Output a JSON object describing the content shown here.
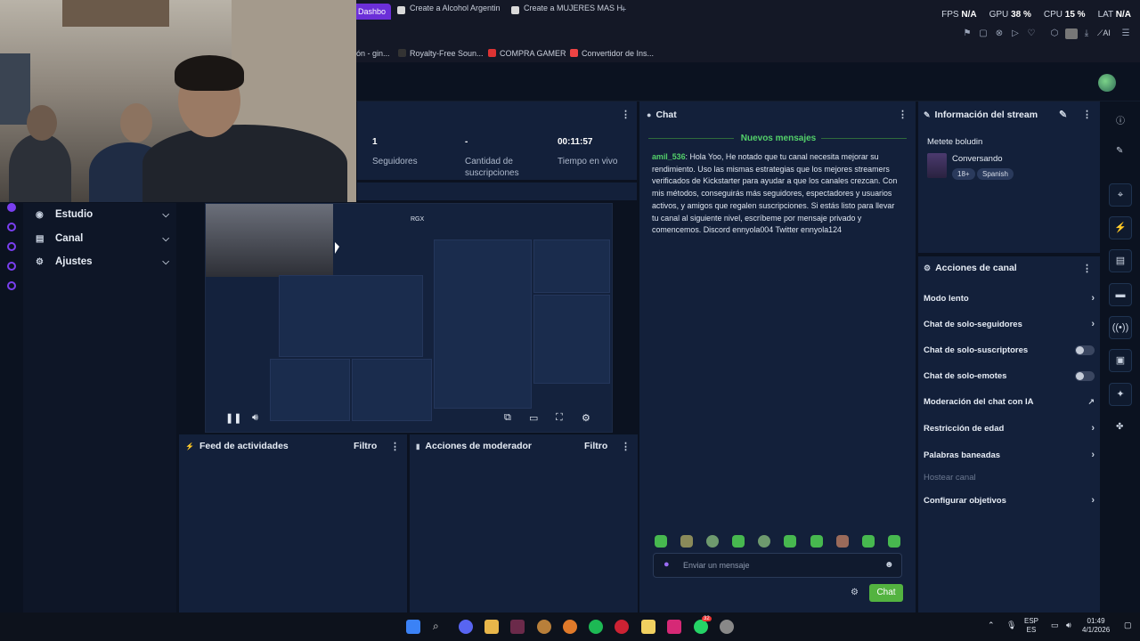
{
  "browser": {
    "tabs": [
      {
        "label": "Dashbo",
        "color": "#7a3ff0",
        "active": true
      },
      {
        "label": "Create a Alcohol Argentin",
        "color": "#d9d9d9",
        "active": false
      },
      {
        "label": "Create a MUJERES MAS H",
        "color": "#d9d9d9",
        "active": false
      }
    ],
    "new_tab": "+",
    "stats": [
      {
        "label": "FPS",
        "value": "N/A"
      },
      {
        "label": "GPU",
        "value": "38 %"
      },
      {
        "label": "CPU",
        "value": "15 %"
      },
      {
        "label": "LAT",
        "value": "N/A"
      }
    ],
    "ai_label": "AI",
    "bookmarks": [
      {
        "label": "ón - gin...",
        "color": "#556"
      },
      {
        "label": "Royalty-Free Soun...",
        "color": "#333"
      },
      {
        "label": "COMPRA GAMER",
        "color": "#d33"
      },
      {
        "label": "Convertidor de Ins...",
        "color": "#e44"
      }
    ]
  },
  "sidebar": {
    "items": [
      {
        "label": "Estudio",
        "icon": "studio-icon"
      },
      {
        "label": "Canal",
        "icon": "channel-icon"
      },
      {
        "label": "Ajustes",
        "icon": "gear-icon"
      }
    ]
  },
  "stats_panel": {
    "followers_value": "1",
    "followers_label": "Seguidores",
    "subs_value": "-",
    "subs_label": "Cantidad de suscripciones",
    "live_value": "00:11:57",
    "live_label": "Tiempo en vivo"
  },
  "video": {
    "overlay_text": "RGX"
  },
  "feed": {
    "title": "Feed de actividades",
    "filter": "Filtro"
  },
  "moderator": {
    "title": "Acciones de moderador",
    "filter": "Filtro"
  },
  "chat": {
    "title": "Chat",
    "new_messages": "Nuevos mensajes",
    "message_user": "amil_536",
    "message_text": ": Hola Yoo, He notado que tu canal necesita mejorar su rendimiento. Uso las mismas estrategias que los mejores streamers verificados de Kickstarter para ayudar a que los canales crezcan. Con mis métodos, conseguirás más seguidores, espectadores y usuarios activos, y amigos que regalen suscripciones. Si estás listo para llevar tu canal al siguiente nivel, escríbeme por mensaje privado y comencemos. Discord ennyola004 Twitter ennyola124",
    "input_placeholder": "Enviar un mensaje",
    "send_label": "Chat"
  },
  "stream_info": {
    "title": "Información del stream",
    "stream_title": "Metete boludin",
    "category": "Conversando",
    "tags": [
      "18+",
      "Spanish"
    ]
  },
  "channel_actions": {
    "title": "Acciones de canal",
    "items": [
      {
        "label": "Modo lento",
        "control": "arrow"
      },
      {
        "label": "Chat de solo-seguidores",
        "control": "arrow"
      },
      {
        "label": "Chat de solo-suscriptores",
        "control": "toggle"
      },
      {
        "label": "Chat de solo-emotes",
        "control": "toggle"
      },
      {
        "label": "Moderación del chat con IA",
        "control": "external"
      },
      {
        "label": "Restricción de edad",
        "control": "arrow"
      },
      {
        "label": "Palabras baneadas",
        "control": "arrow"
      },
      {
        "label": "Hostear canal",
        "control": "disabled"
      },
      {
        "label": "Configurar objetivos",
        "control": "arrow"
      }
    ]
  },
  "taskbar": {
    "lang_top": "ESP",
    "lang_bottom": "ES",
    "time": "01:49",
    "date": "4/1/2026",
    "whatsapp_badge": "32"
  },
  "colors": {
    "accent_green": "#53d16a",
    "brand_purple": "#7a3ff0",
    "panel_bg": "#13203a"
  }
}
